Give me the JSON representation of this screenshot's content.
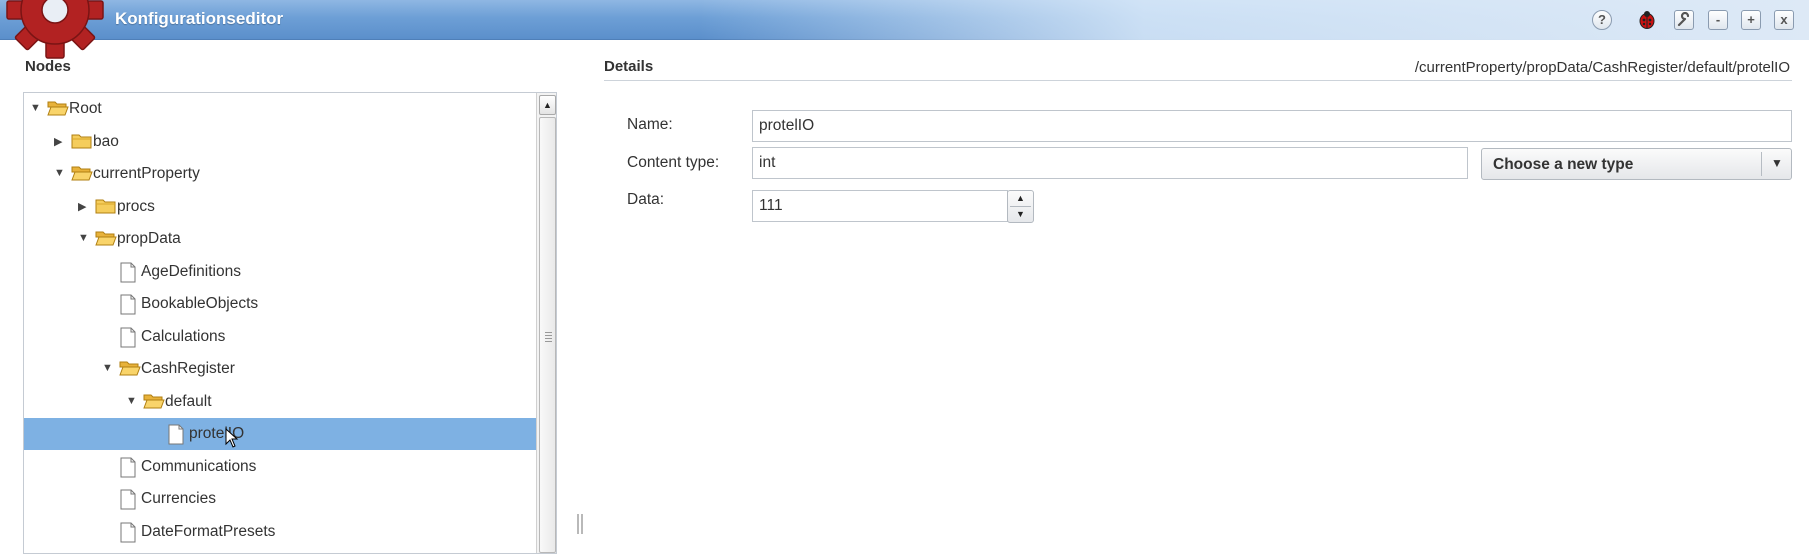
{
  "window": {
    "title": "Konfigurationseditor",
    "colors": {
      "titlebar": "#6d9fd6",
      "selection": "#7eb1e3",
      "gear": "#b22222"
    },
    "controls": [
      {
        "name": "help-button",
        "icon": "question-icon",
        "label": "?"
      },
      {
        "name": "debug-button",
        "icon": "ladybug-icon",
        "label": ""
      },
      {
        "name": "settings-button",
        "icon": "wrench-icon",
        "label": ""
      },
      {
        "name": "minimize-button",
        "icon": "minus-icon",
        "label": "-"
      },
      {
        "name": "maximize-button",
        "icon": "plus-icon",
        "label": "+"
      },
      {
        "name": "close-button",
        "icon": "close-icon",
        "label": "x"
      }
    ]
  },
  "nodes": {
    "header": "Nodes",
    "tree": [
      {
        "label": "Root",
        "kind": "folder",
        "expanded": true,
        "depth": 0
      },
      {
        "label": "bao",
        "kind": "folder",
        "expanded": false,
        "depth": 1
      },
      {
        "label": "currentProperty",
        "kind": "folder",
        "expanded": true,
        "depth": 1
      },
      {
        "label": "procs",
        "kind": "folder",
        "expanded": false,
        "depth": 2
      },
      {
        "label": "propData",
        "kind": "folder",
        "expanded": true,
        "depth": 2
      },
      {
        "label": "AgeDefinitions",
        "kind": "file",
        "depth": 3
      },
      {
        "label": "BookableObjects",
        "kind": "file",
        "depth": 3
      },
      {
        "label": "Calculations",
        "kind": "file",
        "depth": 3
      },
      {
        "label": "CashRegister",
        "kind": "folder",
        "expanded": true,
        "depth": 3
      },
      {
        "label": "default",
        "kind": "folder",
        "expanded": true,
        "depth": 4
      },
      {
        "label": "protelIO",
        "kind": "file",
        "depth": 5,
        "selected": true
      },
      {
        "label": "Communications",
        "kind": "file",
        "depth": 3
      },
      {
        "label": "Currencies",
        "kind": "file",
        "depth": 3
      },
      {
        "label": "DateFormatPresets",
        "kind": "file",
        "depth": 3
      }
    ]
  },
  "details": {
    "header": "Details",
    "path": "/currentProperty/propData/CashRegister/default/protelIO",
    "name_label": "Name:",
    "name_value": "protelIO",
    "content_type_label": "Content type:",
    "content_type_value": "int",
    "type_select": "Choose a new type",
    "data_label": "Data:",
    "data_value": "111"
  }
}
